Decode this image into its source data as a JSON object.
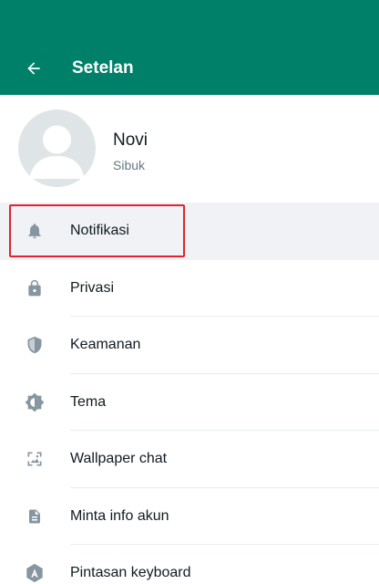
{
  "header": {
    "title": "Setelan",
    "back_icon": "arrow-left-icon",
    "background": "#008069"
  },
  "profile": {
    "name": "Novi",
    "status": "Sibuk"
  },
  "menu": {
    "items": [
      {
        "label": "Notifikasi",
        "icon": "bell-icon",
        "selected": true
      },
      {
        "label": "Privasi",
        "icon": "lock-icon"
      },
      {
        "label": "Keamanan",
        "icon": "shield-icon"
      },
      {
        "label": "Tema",
        "icon": "theme-icon"
      },
      {
        "label": "Wallpaper chat",
        "icon": "wallpaper-icon"
      },
      {
        "label": "Minta info akun",
        "icon": "document-icon"
      },
      {
        "label": "Pintasan keyboard",
        "icon": "keyboard-shortcut-icon"
      }
    ]
  },
  "colors": {
    "accent": "#008069",
    "icon": "#8696a0",
    "highlight": "#e0242e",
    "selected_bg": "#f0f2f5"
  }
}
